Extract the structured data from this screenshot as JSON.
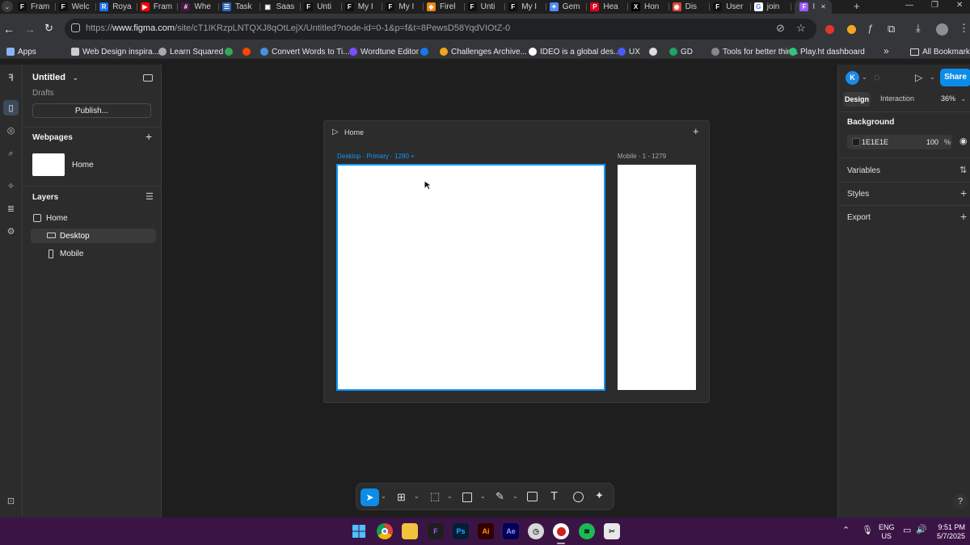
{
  "browser": {
    "tabs": [
      {
        "label": "Fram",
        "color": "#111111",
        "glyph": "F"
      },
      {
        "label": "Welc",
        "color": "#111111",
        "glyph": "F"
      },
      {
        "label": "Roya",
        "color": "#1a73e8",
        "glyph": "R"
      },
      {
        "label": "Fram",
        "color": "#ff0000",
        "glyph": "▶"
      },
      {
        "label": "Whe",
        "color": "#4a154b",
        "glyph": "#"
      },
      {
        "label": "Task",
        "color": "#2d64bc",
        "glyph": "☰"
      },
      {
        "label": "Saas",
        "color": "#1f1f1f",
        "glyph": "▣"
      },
      {
        "label": "Unti",
        "color": "#111111",
        "glyph": "F"
      },
      {
        "label": "My I",
        "color": "#111111",
        "glyph": "F"
      },
      {
        "label": "My I",
        "color": "#111111",
        "glyph": "F"
      },
      {
        "label": "Firel",
        "color": "#f5820d",
        "glyph": "◆"
      },
      {
        "label": "Unti",
        "color": "#111111",
        "glyph": "F"
      },
      {
        "label": "My I",
        "color": "#111111",
        "glyph": "F"
      },
      {
        "label": "Gem",
        "color": "#4f8bf5",
        "glyph": "✦"
      },
      {
        "label": "Hea",
        "color": "#e60023",
        "glyph": "P"
      },
      {
        "label": "Hon",
        "color": "#000000",
        "glyph": "X"
      },
      {
        "label": "Dis",
        "color": "#db4437",
        "glyph": "◉"
      },
      {
        "label": "User",
        "color": "#111111",
        "glyph": "F"
      },
      {
        "label": "join",
        "color": "#ffffff",
        "glyph": "G"
      },
      {
        "label": "I",
        "color": "#a259ff",
        "glyph": "F"
      }
    ],
    "new_tab_glyph": "+",
    "window_controls": {
      "minimize": "—",
      "restore": "❐",
      "close": "✕"
    },
    "url_prefix": "https://",
    "url_domain": "www.figma.com",
    "url_path": "/site/cT1IKRzpLNTQXJ8qOtLejX/Untitled?node-id=0-1&p=f&t=8PewsD58YqdVIOtZ-0",
    "bookmarks": [
      {
        "label": "Apps"
      },
      {
        "label": "Web Design inspira..."
      },
      {
        "label": "Learn Squared"
      },
      {
        "label": ""
      },
      {
        "label": ""
      },
      {
        "label": "Convert Words to Ti..."
      },
      {
        "label": "Wordtune Editor"
      },
      {
        "label": ""
      },
      {
        "label": "Challenges Archive..."
      },
      {
        "label": "IDEO is a global des..."
      },
      {
        "label": "UX"
      },
      {
        "label": ""
      },
      {
        "label": "GD"
      },
      {
        "label": "Tools for better thin..."
      },
      {
        "label": "Play.ht dashboard"
      }
    ],
    "bookmarks_overflow": "»",
    "all_bookmarks": "All Bookmarks"
  },
  "figma": {
    "file_title": "Untitled",
    "file_location": "Drafts",
    "publish_label": "Publish...",
    "webpages_title": "Webpages",
    "webpages": [
      {
        "label": "Home"
      }
    ],
    "layers_title": "Layers",
    "layers": [
      {
        "label": "Home"
      },
      {
        "label": "Desktop"
      },
      {
        "label": "Mobile"
      }
    ],
    "canvas": {
      "page_label": "Home",
      "desktop_label": "Desktop · Primary · 1280 +",
      "mobile_label": "Mobile · 1 - 1279"
    },
    "toolbar": {
      "tools": [
        "move",
        "frame",
        "shape",
        "rectangle",
        "pen",
        "image",
        "text",
        "comment",
        "ai"
      ]
    },
    "right": {
      "avatar_letter": "K",
      "share_label": "Share",
      "tab_design": "Design",
      "tab_interaction": "Interaction",
      "zoom": "36%",
      "background_title": "Background",
      "bg_hex": "1E1E1E",
      "bg_opacity": "100",
      "bg_opacity_unit": "%",
      "variables_title": "Variables",
      "styles_title": "Styles",
      "export_title": "Export",
      "help": "?"
    }
  },
  "taskbar": {
    "language_top": "ENG",
    "language_bottom": "US",
    "time": "9:51 PM",
    "date": "5/7/2025"
  },
  "colors": {
    "accent": "#0d99ff",
    "share": "#0c8ce9",
    "taskbar": "#3b1446"
  }
}
